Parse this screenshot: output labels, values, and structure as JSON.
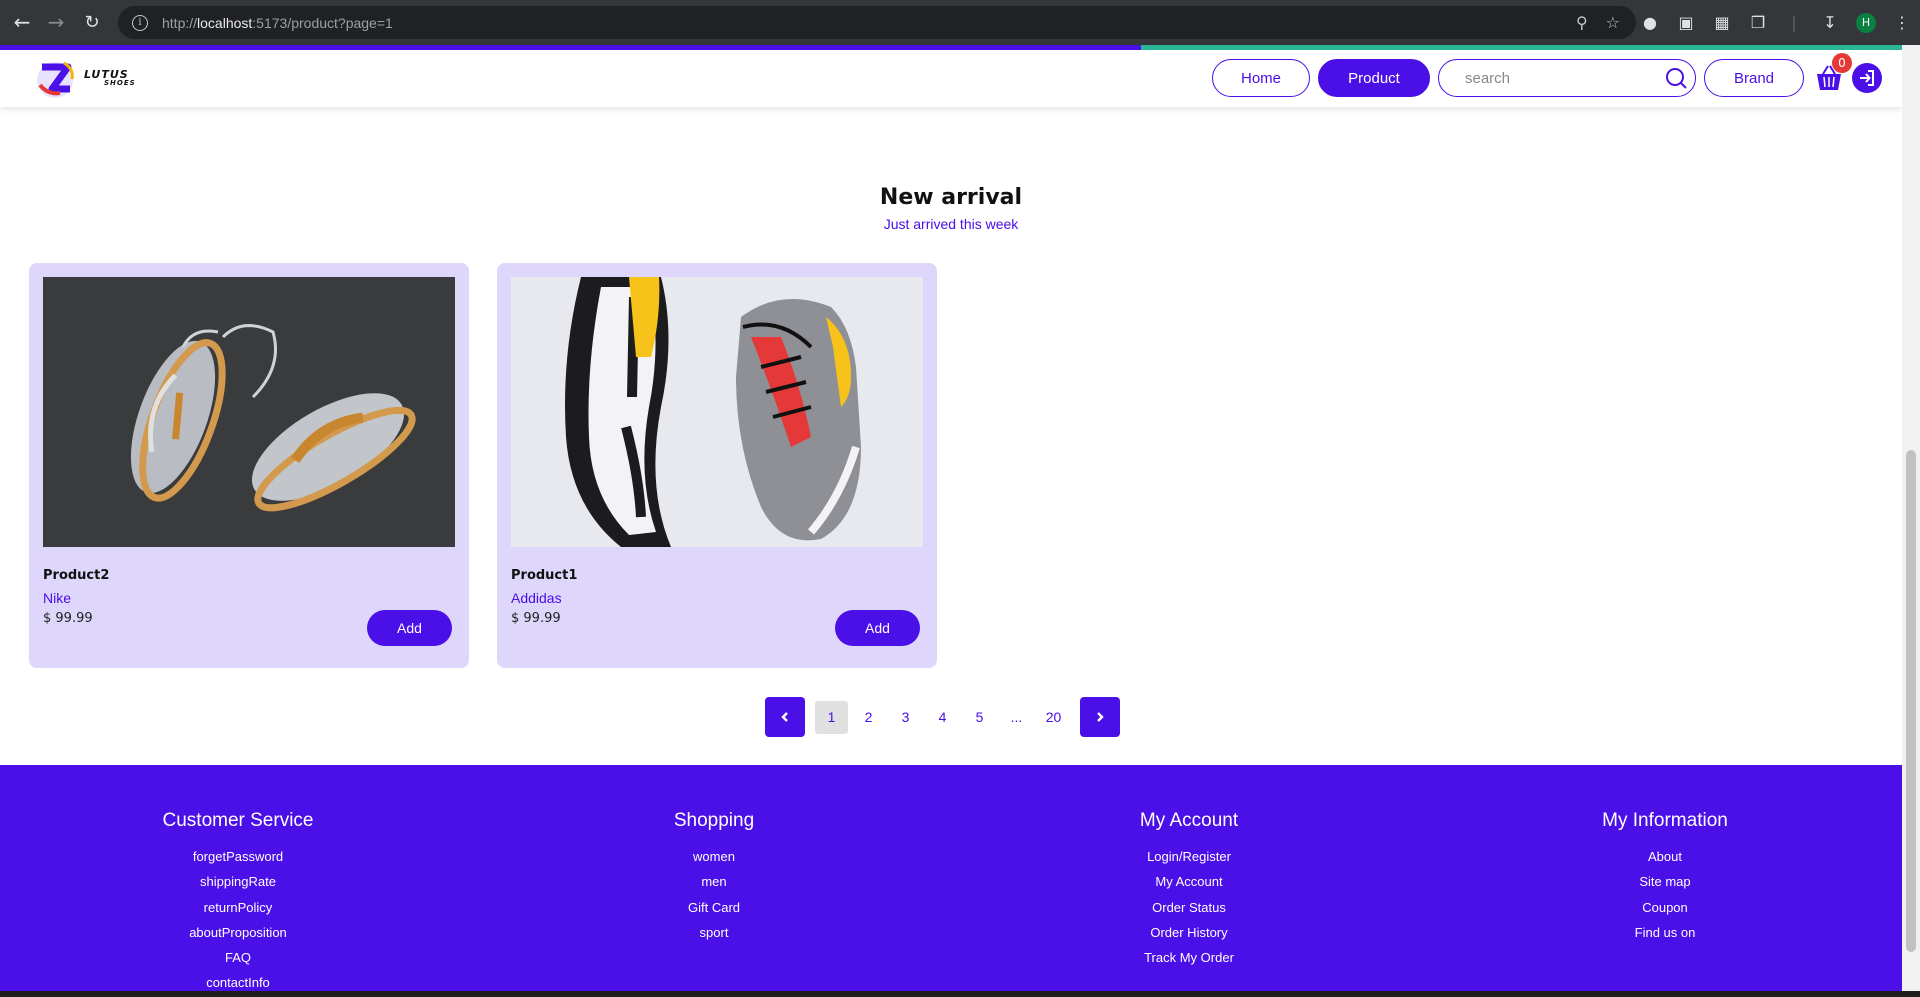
{
  "browser": {
    "url_prefix": "http://",
    "url_host": "localhost",
    "url_rest": ":5173/product?page=1",
    "profile_initial": "H"
  },
  "header": {
    "logo_line1": "LUTUS",
    "logo_line2": "SHOES",
    "nav": {
      "home": "Home",
      "product": "Product",
      "brand": "Brand"
    },
    "search_placeholder": "search",
    "cart_count": "0"
  },
  "section": {
    "title": "New arrival",
    "subtitle": "Just arrived this week"
  },
  "products": [
    {
      "name": "Product2",
      "brand": "Nike",
      "price": "$ 99.99",
      "add_label": "Add"
    },
    {
      "name": "Product1",
      "brand": "Addidas",
      "price": "$ 99.99",
      "add_label": "Add"
    }
  ],
  "pagination": {
    "pages": [
      "1",
      "2",
      "3",
      "4",
      "5",
      "...",
      "20"
    ],
    "current": "1"
  },
  "footer": {
    "customer_service": {
      "title": "Customer Service",
      "links": [
        "forgetPassword",
        "shippingRate",
        "returnPolicy",
        "aboutProposition",
        "FAQ",
        "contactInfo"
      ]
    },
    "shopping": {
      "title": "Shopping",
      "links": [
        "women",
        "men",
        "Gift Card",
        "sport"
      ]
    },
    "my_account": {
      "title": "My Account",
      "links": [
        "Login/Register",
        "My Account",
        "Order Status",
        "Order History",
        "Track My Order"
      ]
    },
    "my_information": {
      "title": "My Information",
      "links": [
        "About",
        "Site map",
        "Coupon",
        "Find us on"
      ]
    }
  },
  "colors": {
    "primary": "#4b0fe8",
    "card_bg": "#ded6fb",
    "badge": "#e53935"
  }
}
